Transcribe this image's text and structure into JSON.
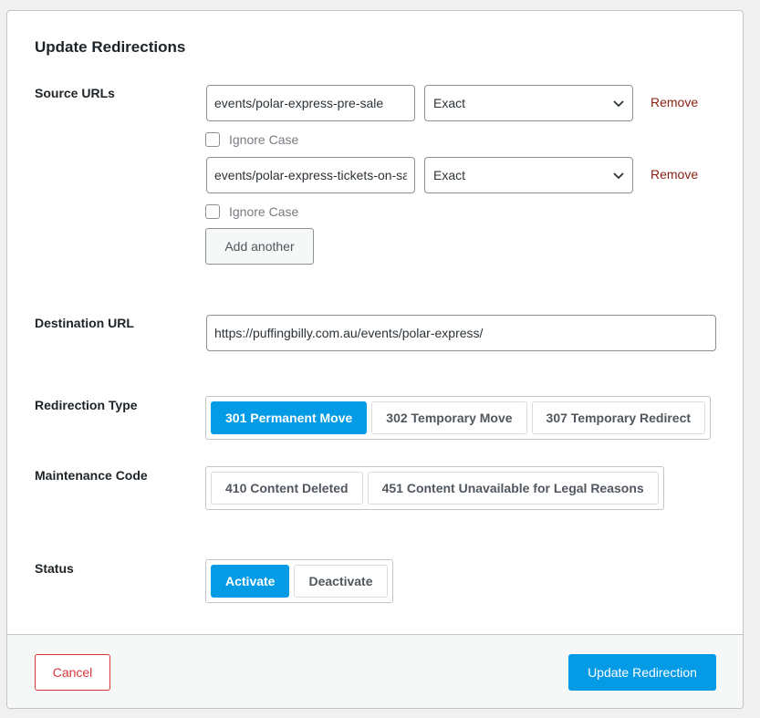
{
  "dialog": {
    "title": "Update Redirections"
  },
  "source": {
    "label": "Source URLs",
    "rows": [
      {
        "url": "events/polar-express-pre-sale",
        "match": "Exact",
        "ignore_case": false
      },
      {
        "url": "events/polar-express-tickets-on-sale",
        "match": "Exact",
        "ignore_case": false
      }
    ],
    "ignore_case_label": "Ignore Case",
    "remove_label": "Remove",
    "add_another_label": "Add another"
  },
  "destination": {
    "label": "Destination URL",
    "value": "https://puffingbilly.com.au/events/polar-express/"
  },
  "redirection_type": {
    "label": "Redirection Type",
    "options": [
      "301 Permanent Move",
      "302 Temporary Move",
      "307 Temporary Redirect"
    ],
    "selected": "301 Permanent Move"
  },
  "maintenance_code": {
    "label": "Maintenance Code",
    "options": [
      "410 Content Deleted",
      "451 Content Unavailable for Legal Reasons"
    ]
  },
  "status": {
    "label": "Status",
    "options": [
      "Activate",
      "Deactivate"
    ],
    "selected": "Activate"
  },
  "footer": {
    "cancel_label": "Cancel",
    "submit_label": "Update Redirection"
  },
  "colors": {
    "accent": "#039be5",
    "danger": "#d63638",
    "remove_link": "#8a1f11"
  }
}
